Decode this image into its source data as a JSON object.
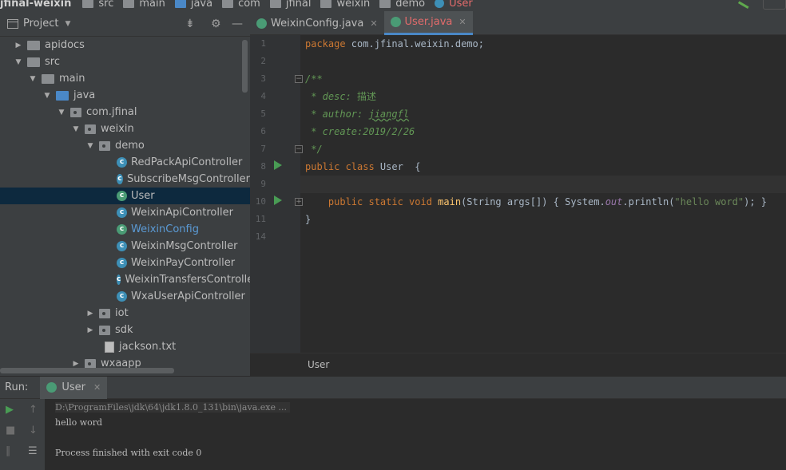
{
  "breadcrumb": {
    "project": "jfinal-weixin",
    "items": [
      "src",
      "main",
      "java",
      "com",
      "jfinal",
      "weixin",
      "demo",
      "User"
    ]
  },
  "project_panel": {
    "title": "Project",
    "tree": [
      {
        "label": "apidocs",
        "type": "folder"
      },
      {
        "label": "src",
        "type": "folder"
      },
      {
        "label": "main",
        "type": "folder"
      },
      {
        "label": "java",
        "type": "source-folder"
      },
      {
        "label": "com.jfinal",
        "type": "package"
      },
      {
        "label": "weixin",
        "type": "package"
      },
      {
        "label": "demo",
        "type": "package"
      },
      {
        "label": "RedPackApiController",
        "type": "class"
      },
      {
        "label": "SubscribeMsgController",
        "type": "class"
      },
      {
        "label": "User",
        "type": "class-run",
        "selected": true
      },
      {
        "label": "WeixinApiController",
        "type": "class"
      },
      {
        "label": "WeixinConfig",
        "type": "class-run",
        "highlight": true
      },
      {
        "label": "WeixinMsgController",
        "type": "class"
      },
      {
        "label": "WeixinPayController",
        "type": "class"
      },
      {
        "label": "WeixinTransfersController",
        "type": "class"
      },
      {
        "label": "WxaUserApiController",
        "type": "class"
      },
      {
        "label": "iot",
        "type": "package"
      },
      {
        "label": "sdk",
        "type": "package"
      },
      {
        "label": "jackson.txt",
        "type": "text-file"
      },
      {
        "label": "wxaapp",
        "type": "package"
      }
    ]
  },
  "editor": {
    "tabs": [
      {
        "label": "WeixinConfig.java",
        "active": false
      },
      {
        "label": "User.java",
        "active": true
      }
    ],
    "line_numbers": [
      "1",
      "2",
      "3",
      "4",
      "5",
      "6",
      "7",
      "8",
      "9",
      "10",
      "11",
      "14"
    ],
    "code": {
      "l1_kw": "package",
      "l1_rest": " com.jfinal.weixin.demo;",
      "l3": "/**",
      "l4_tag": " * desc: ",
      "l4_val": "描述",
      "l5_tag": " * author: ",
      "l5_val": "jiangfl",
      "l6": " * create:2019/2/26",
      "l7": " */",
      "l8_kw": "public class ",
      "l8_rest": "User  {",
      "l10_kw": "    public static void ",
      "l10_fn": "main",
      "l10_a": "(String args[]) { System.",
      "l10_out": "out",
      "l10_b": ".println(",
      "l10_str": "\"hello word\"",
      "l10_c": "); }",
      "l11": "}"
    },
    "breadcrumb": "User"
  },
  "run_panel": {
    "label": "Run:",
    "tab": "User",
    "console": [
      "D:\\ProgramFiles\\jdk\\64\\jdk1.8.0_131\\bin\\java.exe ...",
      "hello word",
      "",
      "Process finished with exit code 0"
    ]
  },
  "colors": {
    "accent": "#4a88c7",
    "active_tab_text": "#e36b6b",
    "selection": "#0d293e",
    "run_green": "#499c54"
  }
}
